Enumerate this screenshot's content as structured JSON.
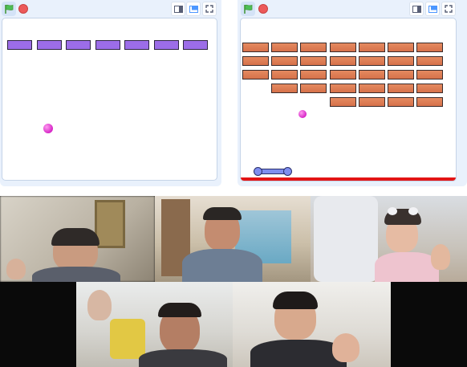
{
  "stages": [
    {
      "id": "left",
      "toolbar": {
        "flag_icon": "green-flag-icon",
        "stop_icon": "stop-icon",
        "views": [
          "small-stage-icon",
          "normal-stage-icon",
          "fullscreen-icon"
        ]
      },
      "bricks": {
        "color": "#9c6de8",
        "rows": 1,
        "count": 7
      },
      "ball_color": "#e040d0"
    },
    {
      "id": "right",
      "toolbar": {
        "flag_icon": "green-flag-icon",
        "stop_icon": "stop-icon",
        "views": [
          "small-stage-icon",
          "normal-stage-icon",
          "fullscreen-icon"
        ]
      },
      "bricks": {
        "color": "#e07d55",
        "rows": 5,
        "row_counts": [
          7,
          7,
          7,
          6,
          4
        ]
      },
      "ball_color": "#e040d0",
      "paddle_color": "#7e8ef0",
      "floor_color": "#e31414"
    }
  ],
  "video_call": {
    "participants": 5
  }
}
